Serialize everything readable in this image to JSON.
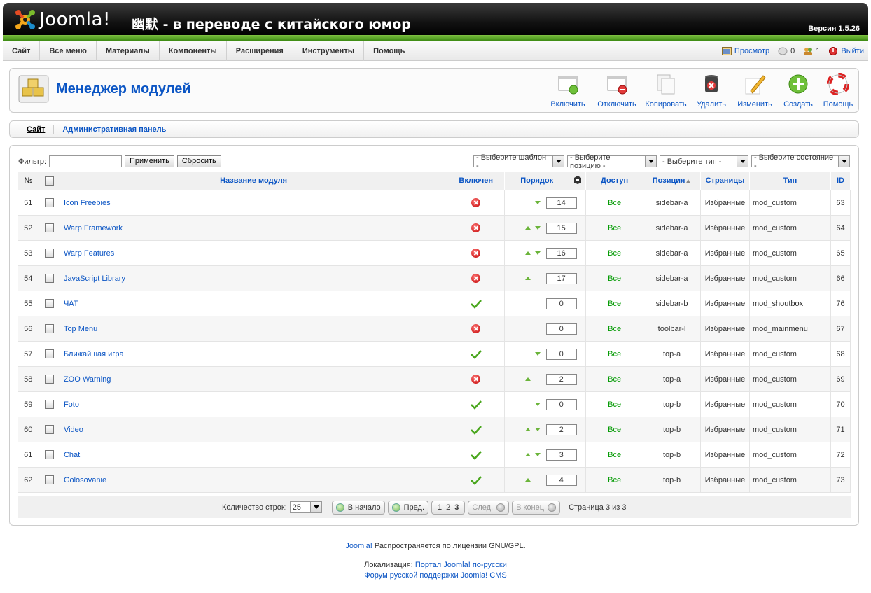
{
  "header": {
    "logo_text": "Joomla!",
    "site_title": "幽默 - в переводе с китайского юмор",
    "version": "Версия 1.5.26"
  },
  "menu": [
    "Сайт",
    "Все меню",
    "Материалы",
    "Компоненты",
    "Расширения",
    "Инструменты",
    "Помощь"
  ],
  "status": {
    "preview": "Просмотр",
    "messages": "0",
    "users": "1",
    "logout": "Выйти"
  },
  "page": {
    "title": "Менеджер модулей"
  },
  "toolbar": {
    "enable": "Включить",
    "disable": "Отключить",
    "copy": "Копировать",
    "delete": "Удалить",
    "edit": "Изменить",
    "create": "Создать",
    "help": "Помощь"
  },
  "submenu": [
    "Сайт",
    "Административная панель"
  ],
  "filter": {
    "label": "Фильтр:",
    "value": "",
    "apply": "Применить",
    "reset": "Сбросить",
    "select_template": "- Выберите шаблон -",
    "select_position": "- Выберите позицию -",
    "select_type": "- Выберите тип -",
    "select_state": "- Выберите состояние -"
  },
  "columns": {
    "num": "№",
    "name": "Название модуля",
    "enabled": "Включен",
    "order": "Порядок",
    "access": "Доступ",
    "position": "Позиция",
    "pages": "Страницы",
    "type": "Тип",
    "id": "ID"
  },
  "rows": [
    {
      "num": "51",
      "name": "Icon Freebies",
      "enabled": false,
      "up": false,
      "down": true,
      "order": "14",
      "access": "Все",
      "position": "sidebar-a",
      "pages": "Избранные",
      "type": "mod_custom",
      "id": "63"
    },
    {
      "num": "52",
      "name": "Warp Framework",
      "enabled": false,
      "up": true,
      "down": true,
      "order": "15",
      "access": "Все",
      "position": "sidebar-a",
      "pages": "Избранные",
      "type": "mod_custom",
      "id": "64"
    },
    {
      "num": "53",
      "name": "Warp Features",
      "enabled": false,
      "up": true,
      "down": true,
      "order": "16",
      "access": "Все",
      "position": "sidebar-a",
      "pages": "Избранные",
      "type": "mod_custom",
      "id": "65"
    },
    {
      "num": "54",
      "name": "JavaScript Library",
      "enabled": false,
      "up": true,
      "down": false,
      "order": "17",
      "access": "Все",
      "position": "sidebar-a",
      "pages": "Избранные",
      "type": "mod_custom",
      "id": "66"
    },
    {
      "num": "55",
      "name": "ЧАТ",
      "enabled": true,
      "up": false,
      "down": false,
      "order": "0",
      "access": "Все",
      "position": "sidebar-b",
      "pages": "Избранные",
      "type": "mod_shoutbox",
      "id": "76"
    },
    {
      "num": "56",
      "name": "Top Menu",
      "enabled": false,
      "up": false,
      "down": false,
      "order": "0",
      "access": "Все",
      "position": "toolbar-l",
      "pages": "Избранные",
      "type": "mod_mainmenu",
      "id": "67"
    },
    {
      "num": "57",
      "name": "Ближайшая игра",
      "enabled": true,
      "up": false,
      "down": true,
      "order": "0",
      "access": "Все",
      "position": "top-a",
      "pages": "Избранные",
      "type": "mod_custom",
      "id": "68"
    },
    {
      "num": "58",
      "name": "ZOO Warning",
      "enabled": false,
      "up": true,
      "down": false,
      "order": "2",
      "access": "Все",
      "position": "top-a",
      "pages": "Избранные",
      "type": "mod_custom",
      "id": "69"
    },
    {
      "num": "59",
      "name": "Foto",
      "enabled": true,
      "up": false,
      "down": true,
      "order": "0",
      "access": "Все",
      "position": "top-b",
      "pages": "Избранные",
      "type": "mod_custom",
      "id": "70"
    },
    {
      "num": "60",
      "name": "Video",
      "enabled": true,
      "up": true,
      "down": true,
      "order": "2",
      "access": "Все",
      "position": "top-b",
      "pages": "Избранные",
      "type": "mod_custom",
      "id": "71"
    },
    {
      "num": "61",
      "name": "Chat",
      "enabled": true,
      "up": true,
      "down": true,
      "order": "3",
      "access": "Все",
      "position": "top-b",
      "pages": "Избранные",
      "type": "mod_custom",
      "id": "72"
    },
    {
      "num": "62",
      "name": "Golosovanie",
      "enabled": true,
      "up": true,
      "down": false,
      "order": "4",
      "access": "Все",
      "position": "top-b",
      "pages": "Избранные",
      "type": "mod_custom",
      "id": "73"
    }
  ],
  "pagination": {
    "rows_label": "Количество строк:",
    "rows_value": "25",
    "first": "В начало",
    "prev": "Пред.",
    "pages": [
      "1",
      "2",
      "3"
    ],
    "current_page": "3",
    "next": "След.",
    "last": "В конец",
    "page_info": "Страница 3 из 3"
  },
  "footer": {
    "joomla_link": "Joomla!",
    "license": " Распространяется по лицензии GNU/GPL.",
    "localization_label": "Локализация: ",
    "portal_link": "Портал Joomla! по-русски",
    "forum_link": "Форум русской поддержки Joomla! CMS"
  },
  "colors": {
    "link": "#0b55c4",
    "access_green": "#009900",
    "header_green": "#5aa62a"
  }
}
